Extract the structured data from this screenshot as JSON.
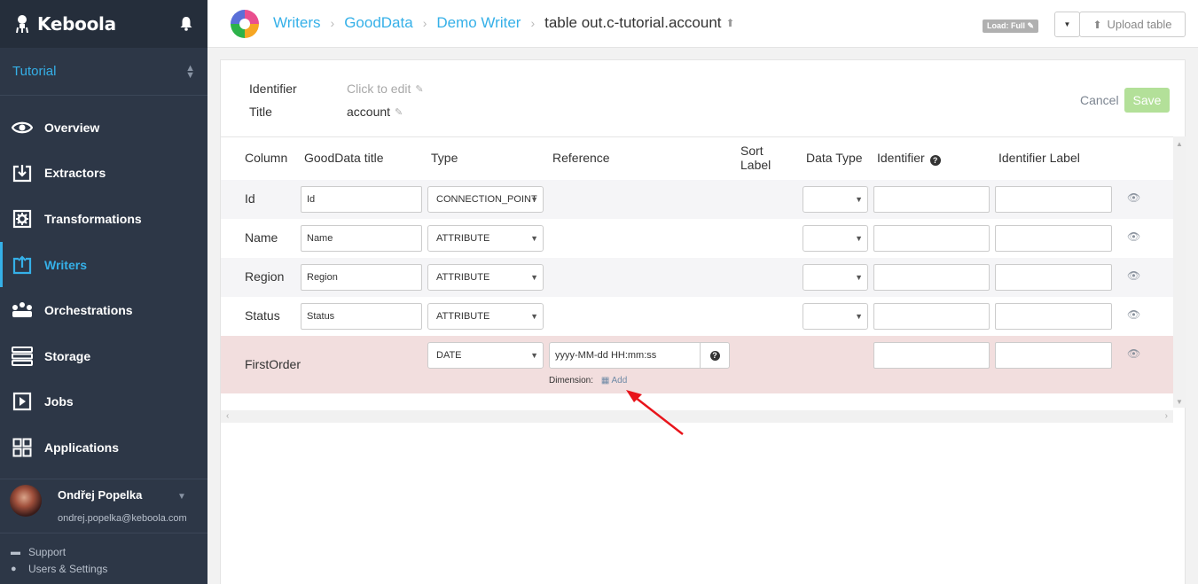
{
  "sidebar": {
    "brand": "Keboola",
    "project": "Tutorial",
    "items": [
      {
        "label": "Overview",
        "icon": "eye-icon"
      },
      {
        "label": "Extractors",
        "icon": "download-box-icon"
      },
      {
        "label": "Transformations",
        "icon": "gear-box-icon"
      },
      {
        "label": "Writers",
        "icon": "upload-box-icon"
      },
      {
        "label": "Orchestrations",
        "icon": "orchestration-icon"
      },
      {
        "label": "Storage",
        "icon": "database-icon"
      },
      {
        "label": "Jobs",
        "icon": "play-box-icon"
      },
      {
        "label": "Applications",
        "icon": "grid-icon"
      }
    ],
    "active_item": "Writers",
    "user": {
      "name": "Ondřej Popelka",
      "email": "ondrej.popelka@keboola.com"
    },
    "footer": {
      "support": "Support",
      "settings": "Users & Settings"
    }
  },
  "header": {
    "breadcrumbs": [
      "Writers",
      "GoodData",
      "Demo Writer"
    ],
    "current": "table out.c-tutorial.account",
    "load_badge": "Load: Full",
    "upload_label": "Upload table"
  },
  "meta": {
    "identifier_label": "Identifier",
    "identifier_value": "Click to edit",
    "title_label": "Title",
    "title_value": "account",
    "cancel": "Cancel",
    "save": "Save"
  },
  "table": {
    "headers": {
      "column": "Column",
      "gd_title": "GoodData title",
      "type": "Type",
      "reference": "Reference",
      "sort_label_1": "Sort",
      "sort_label_2": "Label",
      "data_type": "Data Type",
      "identifier": "Identifier",
      "identifier_label": "Identifier Label"
    },
    "rows": [
      {
        "column": "Id",
        "title": "Id",
        "type": "CONNECTION_POINT"
      },
      {
        "column": "Name",
        "title": "Name",
        "type": "ATTRIBUTE"
      },
      {
        "column": "Region",
        "title": "Region",
        "type": "ATTRIBUTE"
      },
      {
        "column": "Status",
        "title": "Status",
        "type": "ATTRIBUTE"
      },
      {
        "column": "FirstOrder",
        "type": "DATE",
        "format": "yyyy-MM-dd HH:mm:ss",
        "dimension_label": "Dimension:",
        "dimension_add": "Add"
      }
    ],
    "error_row_color": "#f2dede"
  },
  "colors": {
    "accent": "#35b0e8",
    "sidebar": "#2d3747",
    "save_disabled": "#b3e099",
    "arrow": "#e8141b"
  }
}
